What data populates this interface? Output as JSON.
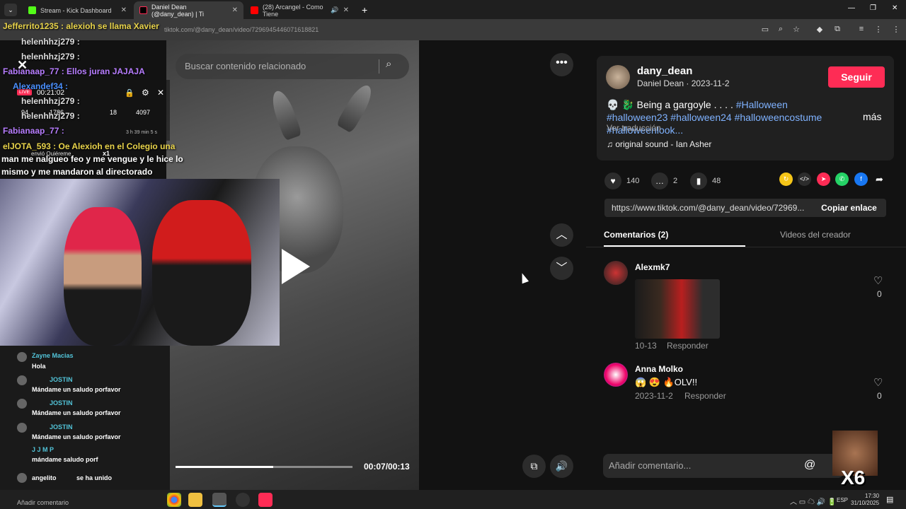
{
  "tabs": [
    {
      "label": "Stream - Kick Dashboard",
      "icon": "kick-icon",
      "color": "#53fc18"
    },
    {
      "label": "Daniel Dean (@dany_dean) | Ti",
      "icon": "tiktok-icon",
      "color": "#fe2c55"
    },
    {
      "label": "(28) Arcangel - Como Tiene",
      "icon": "youtube-icon",
      "color": "#ff0000"
    }
  ],
  "address": {
    "url": "tiktok.com/@dany_dean/video/7296945446071618821"
  },
  "video": {
    "search_placeholder": "Buscar contenido relacionado",
    "time": "00:07/00:13",
    "progress": 0.55
  },
  "author": {
    "username": "dany_dean",
    "display": "Daniel Dean · 2023-11-2",
    "follow": "Seguir",
    "caption_text": "💀 🐉 Being a gargoyle . . . . ",
    "caption_tags": "#Halloween #halloween23 #halloween24 #halloweencostume #halloweenlook...",
    "more": "más",
    "translate": "Ver traducción",
    "sound": "♫  original sound - Ian Asher"
  },
  "stats": {
    "likes": "140",
    "comments": "2",
    "saves": "48"
  },
  "link": {
    "url": "https://www.tiktok.com/@dany_dean/video/72969...",
    "copy": "Copiar enlace"
  },
  "tabs_panel": {
    "comments": "Comentarios (2)",
    "videos": "Videos del creador"
  },
  "comments": [
    {
      "name": "Alexmk7",
      "meta": "10-13",
      "reply": "Responder",
      "likes": "0",
      "text": ""
    },
    {
      "name": "Anna Molko",
      "text": "😱 😍 🔥OLV!!",
      "meta": "2023-11-2",
      "reply": "Responder",
      "likes": "0"
    }
  ],
  "comment_input": {
    "placeholder": "Añadir comentario..."
  },
  "overlay_chat": [
    {
      "text": "Jefferrito1235 : alexioh se llama Xavier",
      "color": "#e8d34a"
    },
    {
      "text": "helenhhzj279 :",
      "color": "#ddd"
    },
    {
      "text": "helenhhzj279 :",
      "color": "#ddd"
    },
    {
      "text": "Fabianaap_77 : Ellos juran JAJAJA",
      "color": "#b77dff"
    },
    {
      "text": "Alexandef34 :",
      "color": "#4a90ff"
    },
    {
      "text": "helenhhzj279 :",
      "color": "#ddd"
    },
    {
      "text": "helenhhzj279 :",
      "color": "#ddd"
    },
    {
      "text": "Fabianaap_77 :",
      "color": "#b77dff"
    },
    {
      "text": "elJOTA_593 : Oe Alexioh en el Colegio una",
      "color": "#e8d34a"
    },
    {
      "text": "man me nalgueo feo y me vengue y le hice lo",
      "color": "#fff"
    },
    {
      "text": "mismo y me mandaron al directorado",
      "color": "#fff"
    }
  ],
  "live_widget": {
    "badge": "LIVE",
    "timer": "00:21:02",
    "viewers": "94",
    "views": "1786",
    "shares": "18",
    "likes": "4097",
    "duration": "3 h 39 min 5 s",
    "gift": "envió Quiéreme",
    "gift_count": "x1"
  },
  "chat_list": [
    {
      "name": "Zayne Macias",
      "msg": "Hola"
    },
    {
      "name": "JOSTIN",
      "msg": "Mándame un saludo porfavor"
    },
    {
      "name": "JOSTIN",
      "msg": "Mándame un saludo porfavor"
    },
    {
      "name": "JOSTIN",
      "msg": "Mándame un saludo porfavor"
    },
    {
      "name": "J J M P",
      "msg": "mándame saludo porf"
    },
    {
      "name": "angelito",
      "msg": "se ha unido"
    }
  ],
  "chat_input": {
    "placeholder": "Añadir comentario"
  },
  "emote": {
    "multiplier": "X6"
  },
  "taskbar": {
    "lang": "ESP",
    "time": "17:30",
    "date": "31/10/2025"
  }
}
